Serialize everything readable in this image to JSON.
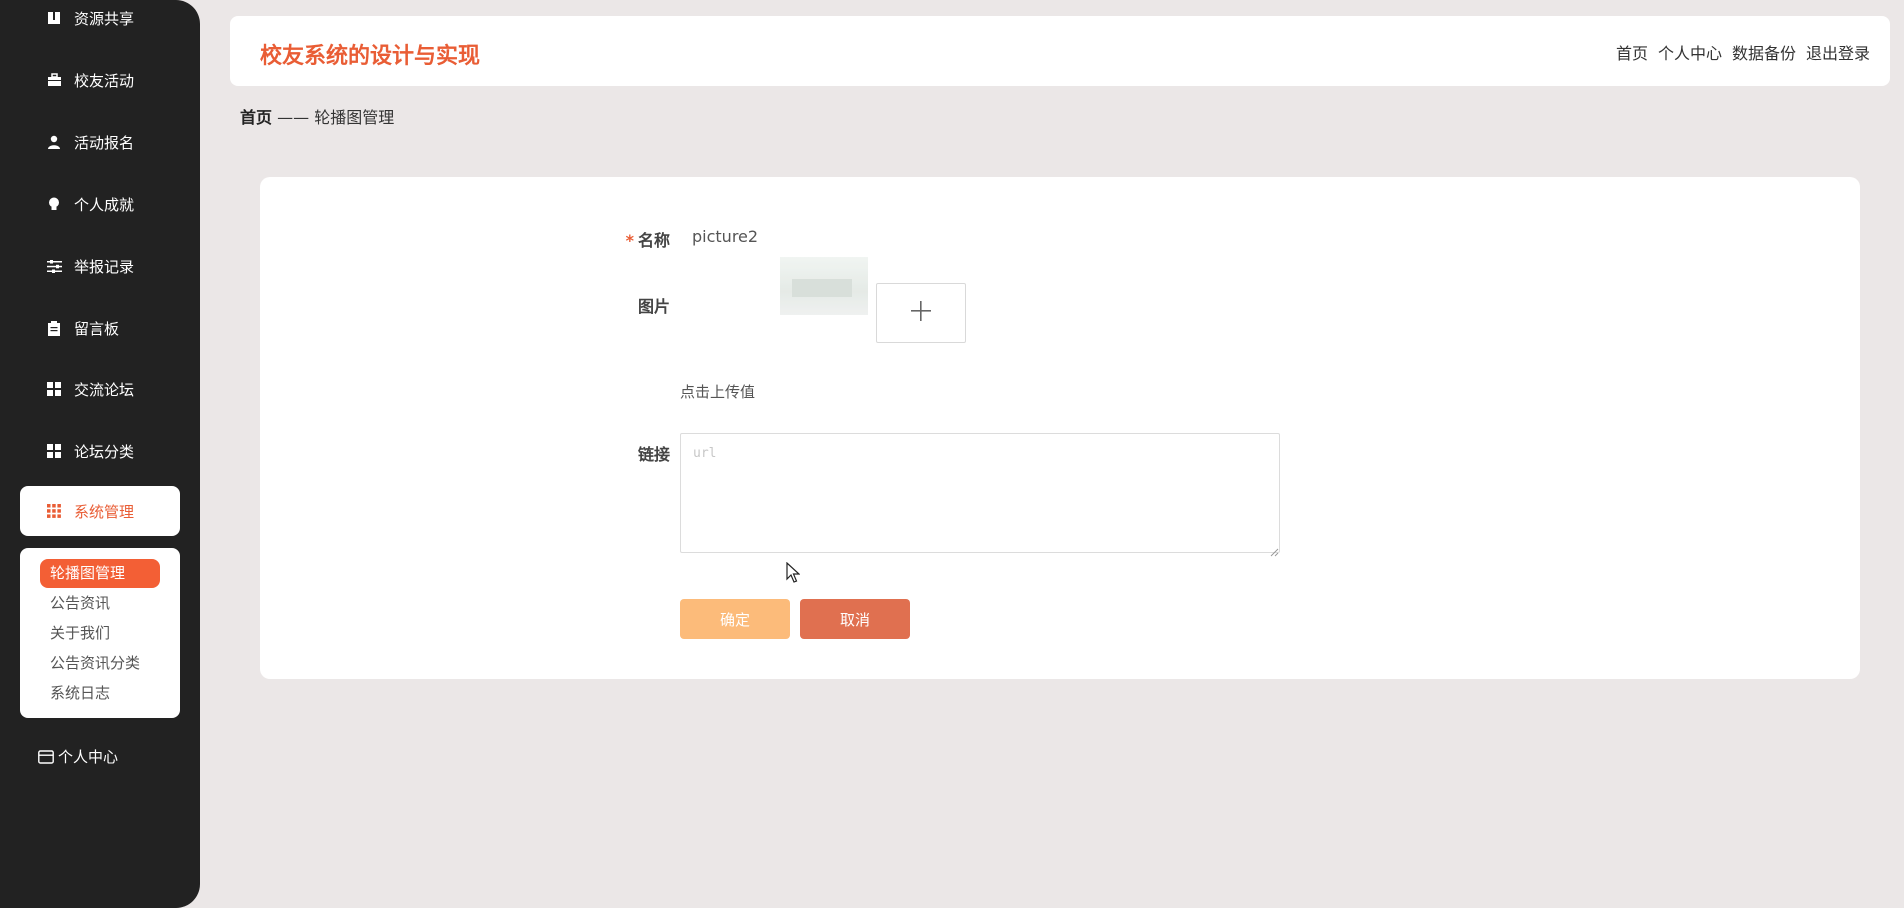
{
  "app": {
    "title": "校友系统的设计与实现"
  },
  "top_nav": [
    "首页",
    "个人中心",
    "数据备份",
    "退出登录"
  ],
  "sidebar": {
    "items": [
      {
        "label": "资源共享",
        "icon": "book-icon"
      },
      {
        "label": "校友活动",
        "icon": "briefcase-icon"
      },
      {
        "label": "活动报名",
        "icon": "user-icon"
      },
      {
        "label": "个人成就",
        "icon": "bulb-icon"
      },
      {
        "label": "举报记录",
        "icon": "sliders-icon"
      },
      {
        "label": "留言板",
        "icon": "clipboard-icon"
      },
      {
        "label": "交流论坛",
        "icon": "grid-icon"
      },
      {
        "label": "论坛分类",
        "icon": "grid-icon"
      },
      {
        "label": "系统管理",
        "icon": "apps-icon"
      }
    ],
    "submenu": [
      "轮播图管理",
      "公告资讯",
      "关于我们",
      "公告资讯分类",
      "系统日志"
    ],
    "bottom_item": {
      "label": "个人中心",
      "icon": "wallet-icon"
    }
  },
  "breadcrumb": {
    "home": "首页",
    "separator": "——",
    "current": "轮播图管理"
  },
  "form": {
    "name_label": "名称",
    "required_mark": "*",
    "name_value": "picture2",
    "image_label": "图片",
    "upload_hint": "点击上传值",
    "link_label": "链接",
    "link_placeholder": "url",
    "ok_label": "确定",
    "cancel_label": "取消"
  },
  "colors": {
    "accent": "#e95d35",
    "sidebar_bg": "#222222",
    "ok_button": "#fcbb7a",
    "cancel_button": "#e07050"
  }
}
